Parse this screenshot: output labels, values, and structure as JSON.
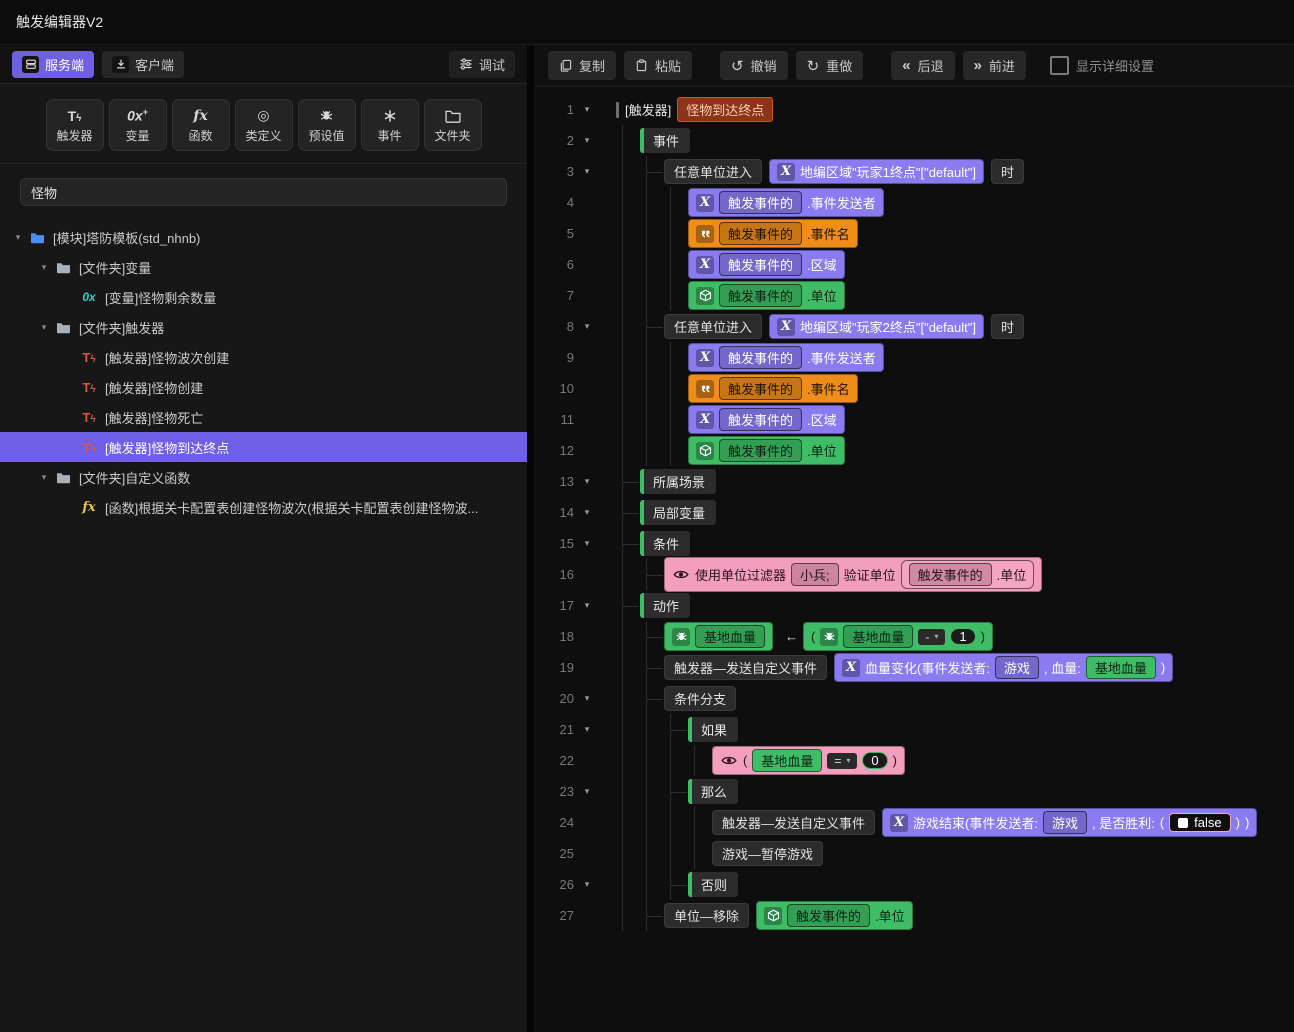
{
  "window": {
    "title": "触发编辑器V2"
  },
  "colors": {
    "accent": "#6f5fe6",
    "purple": "#8a7bf0",
    "orange": "#ee8d1a",
    "green": "#3fbd66",
    "pink": "#f49ebe",
    "rust": "#8a3519"
  },
  "sidebar": {
    "tabs": [
      {
        "label": "服务端",
        "icon": "server-icon",
        "name": "tab-server",
        "active": true
      },
      {
        "label": "客户端",
        "icon": "client-icon",
        "name": "tab-client",
        "active": false
      }
    ],
    "debug": {
      "label": "调试",
      "icon": "debug-icon"
    },
    "tools": [
      {
        "label": "触发器",
        "icon": "tool-trigger-icon",
        "name": "create-trigger-button"
      },
      {
        "label": "变量",
        "icon": "tool-variable-icon",
        "name": "create-variable-button"
      },
      {
        "label": "函数",
        "icon": "tool-function-icon",
        "name": "create-function-button"
      },
      {
        "label": "类定义",
        "icon": "class-icon",
        "name": "create-class-button"
      },
      {
        "label": "预设值",
        "icon": "spider-gray-icon",
        "name": "create-preset-button"
      },
      {
        "label": "事件",
        "icon": "event-asterisk-icon",
        "name": "create-event-button"
      },
      {
        "label": "文件夹",
        "icon": "folder-outline-icon",
        "name": "create-folder-button"
      }
    ],
    "search": {
      "value": "怪物"
    },
    "tree": [
      {
        "depth": 0,
        "type": "module",
        "label": "[模块]塔防模板(std_nhnb)",
        "expanded": true
      },
      {
        "depth": 1,
        "type": "folder",
        "label": "[文件夹]变量",
        "expanded": true
      },
      {
        "depth": 2,
        "type": "variable",
        "label": "[变量]怪物剩余数量"
      },
      {
        "depth": 1,
        "type": "folder",
        "label": "[文件夹]触发器",
        "expanded": true
      },
      {
        "depth": 2,
        "type": "trigger",
        "label": "[触发器]怪物波次创建"
      },
      {
        "depth": 2,
        "type": "trigger",
        "label": "[触发器]怪物创建"
      },
      {
        "depth": 2,
        "type": "trigger",
        "label": "[触发器]怪物死亡"
      },
      {
        "depth": 2,
        "type": "trigger",
        "label": "[触发器]怪物到达终点",
        "selected": true
      },
      {
        "depth": 1,
        "type": "folder",
        "label": "[文件夹]自定义函数",
        "expanded": true
      },
      {
        "depth": 2,
        "type": "function",
        "label": "[函数]根据关卡配置表创建怪物波次(根据关卡配置表创建怪物波..."
      }
    ]
  },
  "editor": {
    "toolbar": [
      {
        "label": "复制",
        "icon": "copy-icon",
        "name": "copy-button"
      },
      {
        "label": "粘贴",
        "icon": "paste-icon",
        "name": "paste-button"
      },
      {
        "label": "撤销",
        "icon": "undo-icon",
        "name": "undo-button"
      },
      {
        "label": "重做",
        "icon": "redo-icon",
        "name": "redo-button"
      },
      {
        "label": "后退",
        "icon": "back-icon",
        "name": "back-button"
      },
      {
        "label": "前进",
        "icon": "forward-icon",
        "name": "forward-button"
      }
    ],
    "show_details": {
      "label": "显示详细设置",
      "checked": false
    },
    "lines": [
      {
        "indent": 0,
        "caret": true,
        "segs": [
          {
            "t": "vbar"
          },
          {
            "t": "text",
            "v": "[触发器]"
          },
          {
            "t": "title",
            "v": "怪物到达终点"
          }
        ]
      },
      {
        "indent": 1,
        "caret": true,
        "segs": [
          {
            "t": "cat",
            "v": "事件",
            "name": "category-event"
          }
        ]
      },
      {
        "indent": 2,
        "caret": true,
        "conn": true,
        "segs": [
          {
            "t": "pill",
            "v": "任意单位进入",
            "name": "event-type-pill"
          },
          {
            "t": "block",
            "c": "purple",
            "name": "region-block",
            "ch": [
              {
                "t": "icon",
                "n": "variable-x-icon"
              },
              {
                "t": "btext",
                "v": "地编区域\"玩家1终点\"[\"default\"]"
              }
            ]
          },
          {
            "t": "pill",
            "v": "时",
            "name": "event-suffix-pill"
          }
        ]
      },
      {
        "indent": 3,
        "segs": [
          {
            "t": "block",
            "c": "purple",
            "name": "param-block",
            "ch": [
              {
                "t": "icon",
                "n": "variable-x-icon"
              },
              {
                "t": "ref",
                "v": "触发事件的"
              },
              {
                "t": "btext",
                "v": ".事件发送者"
              }
            ]
          }
        ]
      },
      {
        "indent": 3,
        "segs": [
          {
            "t": "block",
            "c": "orange",
            "name": "param-block",
            "ch": [
              {
                "t": "icon",
                "n": "string-quote-icon"
              },
              {
                "t": "ref",
                "v": "触发事件的"
              },
              {
                "t": "btext",
                "v": ".事件名"
              }
            ]
          }
        ]
      },
      {
        "indent": 3,
        "segs": [
          {
            "t": "block",
            "c": "purple",
            "name": "param-block",
            "ch": [
              {
                "t": "icon",
                "n": "variable-x-icon"
              },
              {
                "t": "ref",
                "v": "触发事件的"
              },
              {
                "t": "btext",
                "v": ".区域"
              }
            ]
          }
        ]
      },
      {
        "indent": 3,
        "segs": [
          {
            "t": "block",
            "c": "green",
            "name": "param-block",
            "ch": [
              {
                "t": "icon",
                "n": "unit-cube-icon"
              },
              {
                "t": "ref",
                "v": "触发事件的"
              },
              {
                "t": "btext",
                "v": ".单位"
              }
            ]
          }
        ]
      },
      {
        "indent": 2,
        "caret": true,
        "conn": true,
        "segs": [
          {
            "t": "pill",
            "v": "任意单位进入",
            "name": "event-type-pill"
          },
          {
            "t": "block",
            "c": "purple",
            "name": "region-block",
            "ch": [
              {
                "t": "icon",
                "n": "variable-x-icon"
              },
              {
                "t": "btext",
                "v": "地编区域\"玩家2终点\"[\"default\"]"
              }
            ]
          },
          {
            "t": "pill",
            "v": "时",
            "name": "event-suffix-pill"
          }
        ]
      },
      {
        "indent": 3,
        "segs": [
          {
            "t": "block",
            "c": "purple",
            "name": "param-block",
            "ch": [
              {
                "t": "icon",
                "n": "variable-x-icon"
              },
              {
                "t": "ref",
                "v": "触发事件的"
              },
              {
                "t": "btext",
                "v": ".事件发送者"
              }
            ]
          }
        ]
      },
      {
        "indent": 3,
        "segs": [
          {
            "t": "block",
            "c": "orange",
            "name": "param-block",
            "ch": [
              {
                "t": "icon",
                "n": "string-quote-icon"
              },
              {
                "t": "ref",
                "v": "触发事件的"
              },
              {
                "t": "btext",
                "v": ".事件名"
              }
            ]
          }
        ]
      },
      {
        "indent": 3,
        "segs": [
          {
            "t": "block",
            "c": "purple",
            "name": "param-block",
            "ch": [
              {
                "t": "icon",
                "n": "variable-x-icon"
              },
              {
                "t": "ref",
                "v": "触发事件的"
              },
              {
                "t": "btext",
                "v": ".区域"
              }
            ]
          }
        ]
      },
      {
        "indent": 3,
        "segs": [
          {
            "t": "block",
            "c": "green",
            "name": "param-block",
            "ch": [
              {
                "t": "icon",
                "n": "unit-cube-icon"
              },
              {
                "t": "ref",
                "v": "触发事件的"
              },
              {
                "t": "btext",
                "v": ".单位"
              }
            ]
          }
        ]
      },
      {
        "indent": 1,
        "caret": true,
        "conn": true,
        "segs": [
          {
            "t": "cat",
            "v": "所属场景",
            "name": "category-scene"
          }
        ]
      },
      {
        "indent": 1,
        "caret": true,
        "conn": true,
        "segs": [
          {
            "t": "cat",
            "v": "局部变量",
            "name": "category-local-vars"
          }
        ]
      },
      {
        "indent": 1,
        "caret": true,
        "conn": true,
        "segs": [
          {
            "t": "cat",
            "v": "条件",
            "name": "category-conditions"
          }
        ]
      },
      {
        "indent": 2,
        "conn": true,
        "segs": [
          {
            "t": "block",
            "c": "pink",
            "name": "condition-block",
            "ch": [
              {
                "t": "icon",
                "n": "eye-icon",
                "bare": true
              },
              {
                "t": "btext",
                "v": "使用单位过滤器"
              },
              {
                "t": "ref",
                "v": "小兵;"
              },
              {
                "t": "btext",
                "v": "验证单位"
              },
              {
                "t": "group",
                "name": "unit-group",
                "ch": [
                  {
                    "t": "ref",
                    "v": "触发事件的"
                  },
                  {
                    "t": "btext",
                    "v": ".单位"
                  }
                ]
              }
            ]
          }
        ]
      },
      {
        "indent": 1,
        "caret": true,
        "conn": true,
        "segs": [
          {
            "t": "cat",
            "v": "动作",
            "name": "category-actions"
          }
        ]
      },
      {
        "indent": 2,
        "conn": true,
        "segs": [
          {
            "t": "block",
            "c": "green",
            "name": "variable-chip",
            "ch": [
              {
                "t": "icon",
                "n": "spider-icon"
              },
              {
                "t": "ref",
                "v": "基地血量"
              }
            ]
          },
          {
            "t": "arrow",
            "v": "←"
          },
          {
            "t": "block",
            "c": "green",
            "name": "expression-block",
            "ch": [
              {
                "t": "btext",
                "v": "("
              },
              {
                "t": "icon",
                "n": "spider-icon"
              },
              {
                "t": "ref",
                "v": "基地血量"
              },
              {
                "t": "drop",
                "v": "-"
              },
              {
                "t": "num",
                "v": "1"
              },
              {
                "t": "btext",
                "v": ")"
              }
            ]
          }
        ]
      },
      {
        "indent": 2,
        "conn": true,
        "segs": [
          {
            "t": "pill",
            "v": "触发器—发送自定义事件",
            "name": "action-pill"
          },
          {
            "t": "block",
            "c": "purple",
            "name": "event-call-block",
            "ch": [
              {
                "t": "icon",
                "n": "variable-x-icon"
              },
              {
                "t": "btext",
                "v": "血量变化(事件发送者:"
              },
              {
                "t": "ref",
                "v": "游戏"
              },
              {
                "t": "btext",
                "v": ", 血量:"
              },
              {
                "t": "greenref",
                "v": "基地血量"
              },
              {
                "t": "btext",
                "v": ")"
              }
            ]
          }
        ]
      },
      {
        "indent": 2,
        "caret": true,
        "conn": true,
        "segs": [
          {
            "t": "pill",
            "v": "条件分支",
            "name": "branch-pill"
          }
        ]
      },
      {
        "indent": 3,
        "caret": true,
        "conn": true,
        "segs": [
          {
            "t": "cat",
            "v": "如果",
            "name": "category-if"
          }
        ]
      },
      {
        "indent": 4,
        "segs": [
          {
            "t": "block",
            "c": "pink",
            "name": "condition-block",
            "ch": [
              {
                "t": "icon",
                "n": "eye-icon",
                "bare": true
              },
              {
                "t": "btext",
                "v": "("
              },
              {
                "t": "greenref",
                "v": "基地血量"
              },
              {
                "t": "drop",
                "v": "="
              },
              {
                "t": "num",
                "v": "0"
              },
              {
                "t": "btext",
                "v": ")"
              }
            ]
          }
        ]
      },
      {
        "indent": 3,
        "caret": true,
        "conn": true,
        "segs": [
          {
            "t": "cat",
            "v": "那么",
            "name": "category-then"
          }
        ]
      },
      {
        "indent": 4,
        "segs": [
          {
            "t": "pill",
            "v": "触发器—发送自定义事件",
            "name": "action-pill"
          },
          {
            "t": "block",
            "c": "purple",
            "name": "event-call-block",
            "ch": [
              {
                "t": "icon",
                "n": "variable-x-icon"
              },
              {
                "t": "btext",
                "v": "游戏结束(事件发送者:"
              },
              {
                "t": "ref",
                "v": "游戏"
              },
              {
                "t": "btext",
                "v": ", 是否胜利:"
              },
              {
                "t": "btext",
                "v": "("
              },
              {
                "t": "bool",
                "v": "false"
              },
              {
                "t": "btext",
                "v": ")"
              },
              {
                "t": "btext",
                "v": ")"
              }
            ]
          }
        ]
      },
      {
        "indent": 4,
        "segs": [
          {
            "t": "pill",
            "v": "游戏—暂停游戏",
            "name": "action-pill"
          }
        ]
      },
      {
        "indent": 3,
        "caret": true,
        "conn": true,
        "segs": [
          {
            "t": "cat",
            "v": "否则",
            "name": "category-else"
          }
        ]
      },
      {
        "indent": 2,
        "conn": true,
        "segs": [
          {
            "t": "pill",
            "v": "单位—移除",
            "name": "action-pill"
          },
          {
            "t": "block",
            "c": "green",
            "name": "unit-block",
            "ch": [
              {
                "t": "icon",
                "n": "unit-cube-icon"
              },
              {
                "t": "ref",
                "v": "触发事件的"
              },
              {
                "t": "btext",
                "v": ".单位"
              }
            ]
          }
        ]
      }
    ]
  }
}
